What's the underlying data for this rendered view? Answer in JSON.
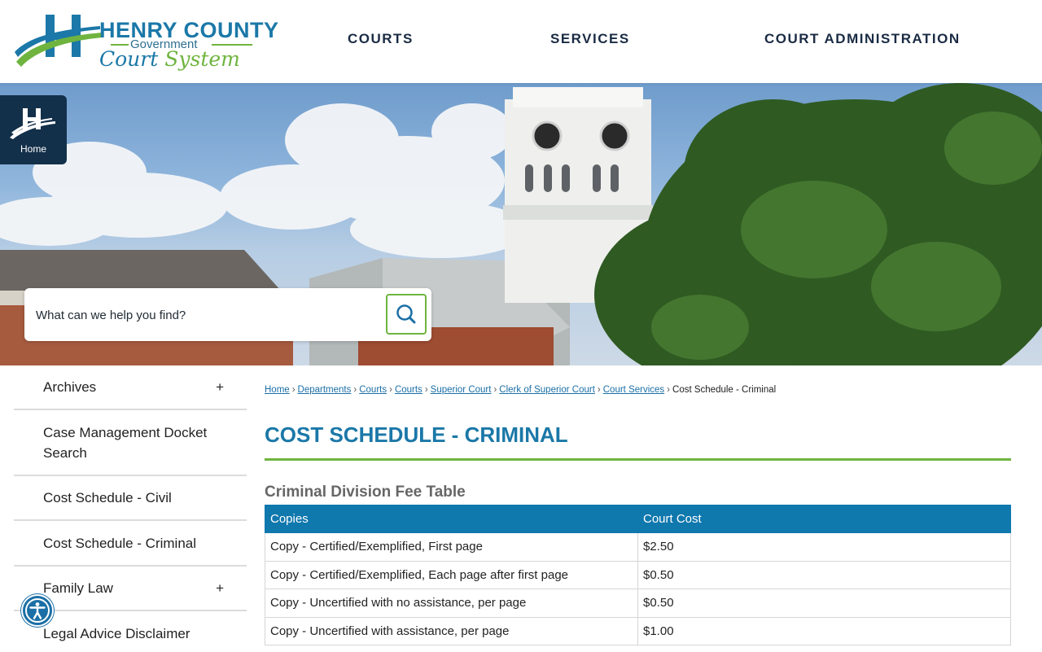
{
  "brand": {
    "title": "HENRY COUNTY",
    "subtitle": "Government",
    "script_line1": "Court",
    "script_line2": "System",
    "colors": {
      "blue": "#1b78a8",
      "green": "#6fb43f",
      "navy": "#13304a"
    }
  },
  "nav": [
    {
      "label": "COURTS"
    },
    {
      "label": "SERVICES"
    },
    {
      "label": "COURT ADMINISTRATION"
    }
  ],
  "home_tab": {
    "label": "Home",
    "icon": "henry-h-logo-icon"
  },
  "search": {
    "placeholder": "What can we help you find?",
    "icon": "search-icon"
  },
  "sidebar": {
    "items": [
      {
        "label": "Archives",
        "expand": "+"
      },
      {
        "label": "Case Management Docket Search"
      },
      {
        "label": "Cost Schedule - Civil"
      },
      {
        "label": "Cost Schedule - Criminal"
      },
      {
        "label": "Family Law",
        "expand": "+"
      },
      {
        "label": "Legal Advice Disclaimer"
      }
    ]
  },
  "breadcrumb": {
    "links": [
      "Home",
      "Departments",
      "Courts",
      "Courts",
      "Superior Court",
      "Clerk of Superior Court",
      "Court Services"
    ],
    "current": "Cost Schedule - Criminal",
    "separator": "›"
  },
  "page": {
    "title": "COST SCHEDULE - CRIMINAL",
    "table_caption": "Criminal Division Fee Table"
  },
  "fee_table": {
    "headers": [
      "Copies",
      "Court Cost"
    ],
    "rows": [
      [
        "Copy - Certified/Exemplified, First page",
        "$2.50"
      ],
      [
        "Copy - Certified/Exemplified, Each page after first page",
        "$0.50"
      ],
      [
        "Copy - Uncertified with no assistance, per page",
        "$0.50"
      ],
      [
        "Copy - Uncertified with assistance, per page",
        "$1.00"
      ]
    ]
  },
  "accessibility": {
    "icon": "accessibility-icon"
  }
}
